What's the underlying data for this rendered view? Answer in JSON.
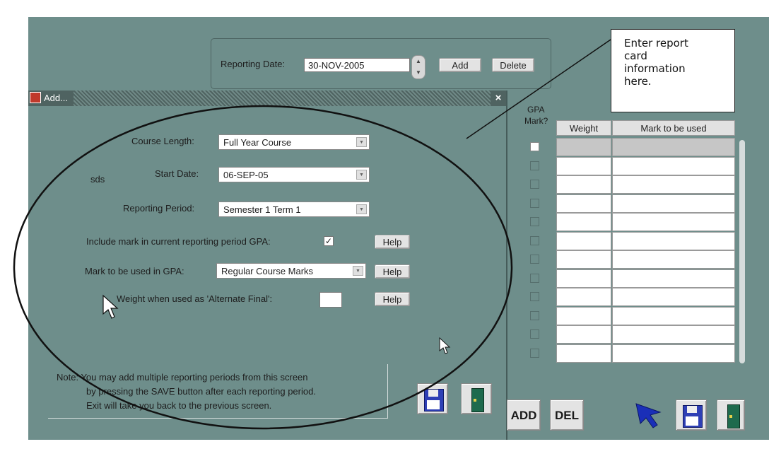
{
  "top_form": {
    "reporting_date_label": "Reporting Date:",
    "reporting_date_value": "30-NOV-2005",
    "add_label": "Add",
    "delete_label": "Delete"
  },
  "dialog": {
    "title": "Add...",
    "close": "×",
    "course_length_label": "Course Length:",
    "course_length_value": "Full Year Course",
    "sds_label": "sds",
    "start_date_label": "Start Date:",
    "start_date_value": "06-SEP-05",
    "reporting_period_label": "Reporting Period:",
    "reporting_period_value": "Semester 1 Term 1",
    "include_mark_label": "Include mark in current reporting period GPA:",
    "include_mark_checked": true,
    "mark_in_gpa_label": "Mark to be used in GPA:",
    "mark_in_gpa_value": "Regular Course Marks",
    "weight_label": "Weight when used as 'Alternate Final':",
    "weight_value": "",
    "help_label": "Help",
    "note_lines": [
      "Note:  You may add multiple reporting periods from this screen",
      "by pressing the SAVE button after each reporting period.",
      "Exit will take you back to the previous screen."
    ]
  },
  "grid": {
    "gpa_header_1": "GPA",
    "gpa_header_2": "Mark?",
    "weight_header": "Weight",
    "mark_header": "Mark to be used",
    "row_count": 12
  },
  "bottom_buttons": {
    "add": "ADD",
    "del": "DEL"
  },
  "callout": {
    "lines": [
      "Enter report",
      "card",
      "information",
      "here."
    ]
  },
  "icons": [
    "save-icon",
    "exit-door-icon",
    "pointer-arrow-icon",
    "mouse-cursor-icon",
    "combo-arrow-icon",
    "spinner-icon"
  ],
  "colors": {
    "background": "#6e8e8b",
    "titlebar": "#4f6361",
    "field": "#ffffff",
    "button": "#e3e3e3",
    "ellipse": "#111111",
    "pointer": "#1a2fb8"
  }
}
